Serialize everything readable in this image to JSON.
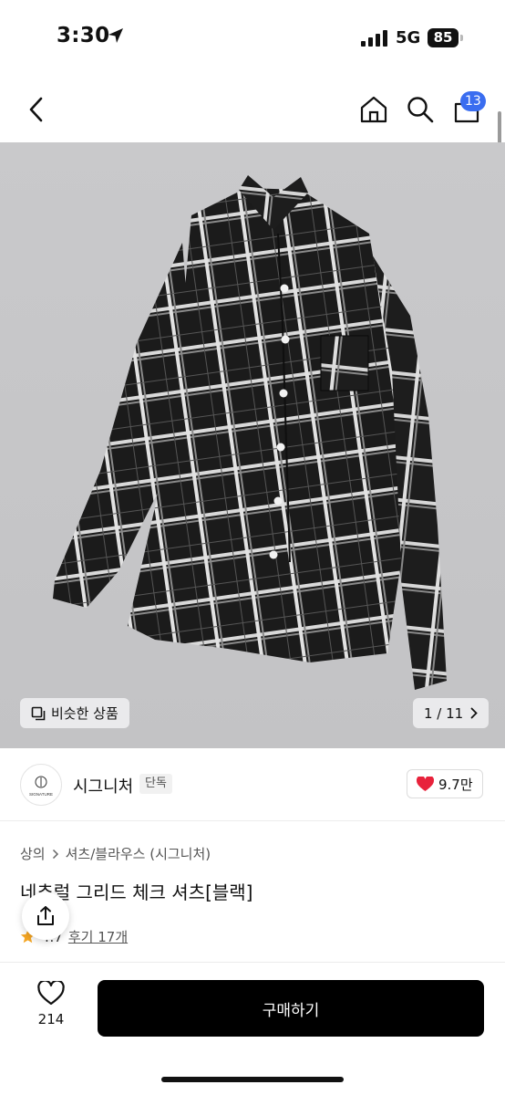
{
  "status_bar": {
    "time": "3:30",
    "network": "5G",
    "battery": "85"
  },
  "header": {
    "cart_count": "13"
  },
  "gallery": {
    "similar_label": "비슷한 상품",
    "counter": "1 / 11"
  },
  "brand": {
    "name": "시그니처",
    "badge": "단독",
    "logo_text": "SIGNATURE",
    "likes": "9.7만"
  },
  "breadcrumb": {
    "category": "상의",
    "subcategory": "셔츠/블라우스 (시그니처)"
  },
  "product": {
    "title": "네츄럴 그리드 체크 셔츠[블랙]",
    "rating": "4.7",
    "reviews": "후기 17개"
  },
  "bottom_bar": {
    "wish_count": "214",
    "buy_label": "구매하기"
  },
  "colors": {
    "accent_blue": "#3a6df0",
    "heart_red": "#e8223b",
    "star_orange": "#f5a623",
    "buy_black": "#000000"
  }
}
